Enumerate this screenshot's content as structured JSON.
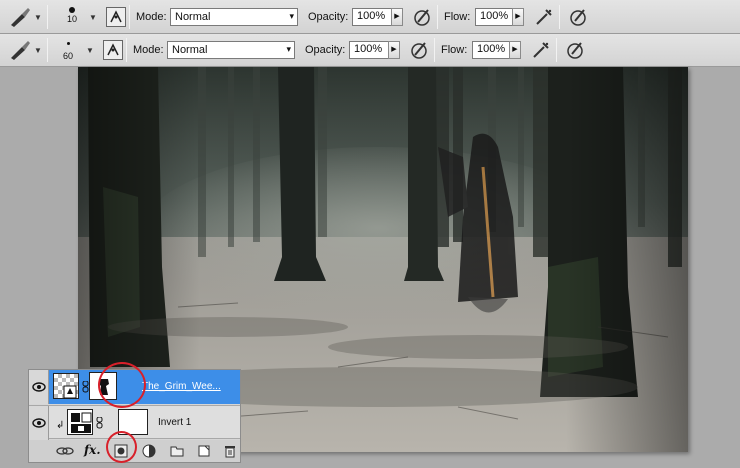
{
  "toolbar_top": {
    "brush_size": "10",
    "mode_label": "Mode:",
    "mode_value": "Normal",
    "opacity_label": "Opacity:",
    "opacity_value": "100%",
    "flow_label": "Flow:",
    "flow_value": "100%"
  },
  "toolbar_second": {
    "brush_size": "60",
    "mode_label": "Mode:",
    "mode_value": "Normal",
    "opacity_label": "Opacity:",
    "opacity_value": "100%",
    "flow_label": "Flow:",
    "flow_value": "100%"
  },
  "layers": [
    {
      "name": "The_Grim_Wee...",
      "selected": true
    },
    {
      "name": "Invert 1",
      "selected": false
    }
  ],
  "colors": {
    "selection": "#3d8ee8",
    "highlight_circle": "#d8202a"
  }
}
